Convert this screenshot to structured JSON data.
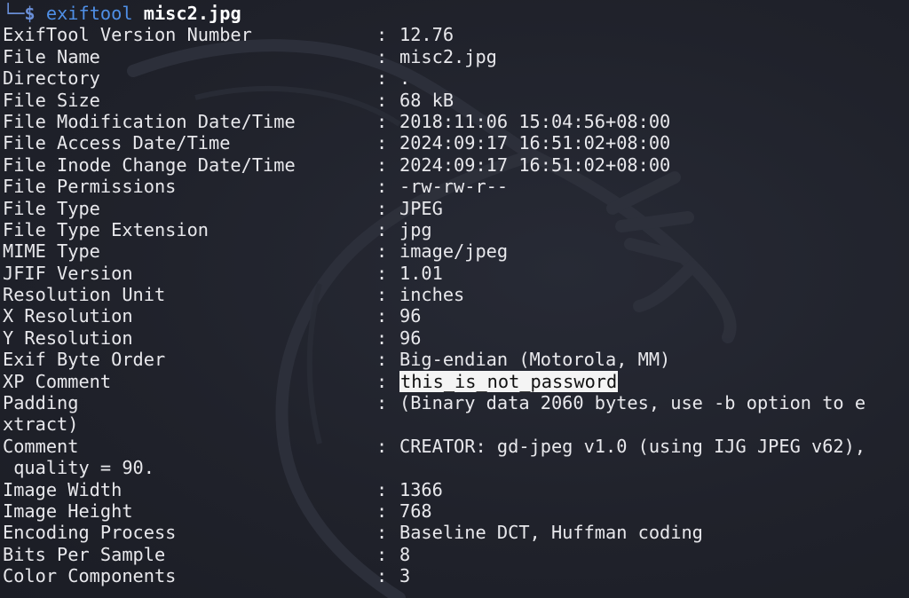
{
  "prompt": {
    "corner": "└─",
    "symbol": "$",
    "command": "exiftool",
    "argument": "misc2.jpg"
  },
  "rows": [
    {
      "key": "ExifTool Version Number",
      "value": "12.76"
    },
    {
      "key": "File Name",
      "value": "misc2.jpg"
    },
    {
      "key": "Directory",
      "value": "."
    },
    {
      "key": "File Size",
      "value": "68 kB"
    },
    {
      "key": "File Modification Date/Time",
      "value": "2018:11:06 15:04:56+08:00"
    },
    {
      "key": "File Access Date/Time",
      "value": "2024:09:17 16:51:02+08:00"
    },
    {
      "key": "File Inode Change Date/Time",
      "value": "2024:09:17 16:51:02+08:00"
    },
    {
      "key": "File Permissions",
      "value": "-rw-rw-r--"
    },
    {
      "key": "File Type",
      "value": "JPEG"
    },
    {
      "key": "File Type Extension",
      "value": "jpg"
    },
    {
      "key": "MIME Type",
      "value": "image/jpeg"
    },
    {
      "key": "JFIF Version",
      "value": "1.01"
    },
    {
      "key": "Resolution Unit",
      "value": "inches"
    },
    {
      "key": "X Resolution",
      "value": "96"
    },
    {
      "key": "Y Resolution",
      "value": "96"
    },
    {
      "key": "Exif Byte Order",
      "value": "Big-endian (Motorola, MM)"
    },
    {
      "key": "XP Comment",
      "value": "this_is_not_password"
    },
    {
      "key": "Padding",
      "value": "(Binary data 2060 bytes, use -b option to e"
    },
    {
      "key": "xtract)",
      "value": ""
    },
    {
      "key": "Comment",
      "value": "CREATOR: gd-jpeg v1.0 (using IJG JPEG v62),"
    },
    {
      "key": " quality = 90.",
      "value": ""
    },
    {
      "key": "Image Width",
      "value": "1366"
    },
    {
      "key": "Image Height",
      "value": "768"
    },
    {
      "key": "Encoding Process",
      "value": "Baseline DCT, Huffman coding"
    },
    {
      "key": "Bits Per Sample",
      "value": "8"
    },
    {
      "key": "Color Components",
      "value": "3"
    }
  ],
  "separator": ":",
  "colors": {
    "background": "#1f212a",
    "text": "#e8e8ec",
    "command": "#4f8fe6",
    "highlight_bg": "#f4f4f4",
    "highlight_text": "#111111"
  },
  "icons": {
    "watermark": "kali-dragon-icon"
  }
}
